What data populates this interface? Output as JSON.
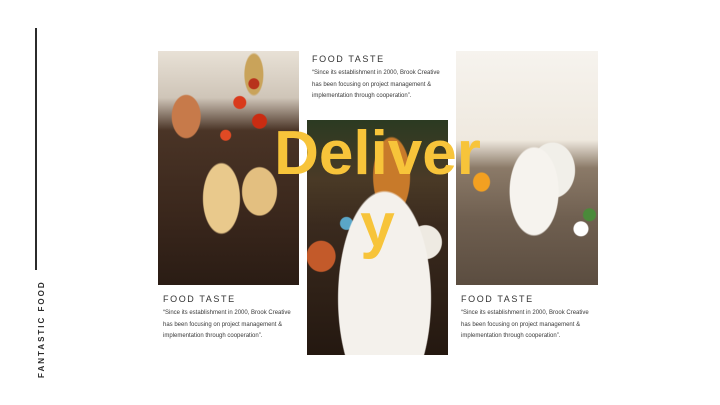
{
  "slide": {
    "vertical_label": "FANTASTIC FOOD",
    "overlay_word": "Delivery",
    "accent_color": "#f7c43a",
    "cards": [
      {
        "title": "FOOD TASTE",
        "body": "“Since its establishment in 2000, Brook Creative has been focusing on project management & implementation through cooperation”."
      },
      {
        "title": "FOOD TASTE",
        "body": "“Since its establishment in 2000, Brook Creative has been focusing on project management & implementation through cooperation”."
      },
      {
        "title": "FOOD TASTE",
        "body": "“Since its establishment in 2000, Brook Creative has been focusing on project management & implementation through cooperation”."
      }
    ],
    "photos": [
      {
        "subject": "bruschetta-with-tomatoes"
      },
      {
        "subject": "salad-bowl-with-vegetables"
      },
      {
        "subject": "breakfast-table-with-orange-juice"
      }
    ]
  }
}
